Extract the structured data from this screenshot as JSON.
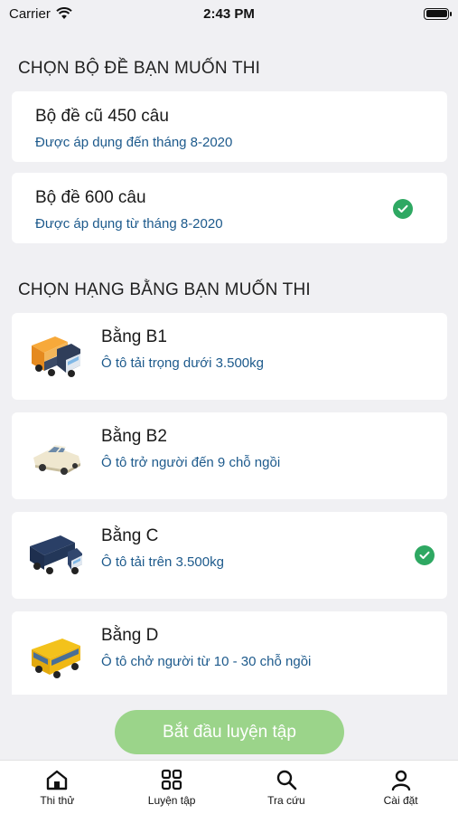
{
  "status_bar": {
    "carrier": "Carrier",
    "time": "2:43 PM"
  },
  "exam_set": {
    "heading": "CHỌN BỘ ĐỀ BẠN MUỐN THI",
    "options": [
      {
        "title": "Bộ đề cũ 450 câu",
        "subtitle": "Được áp dụng đến tháng 8-2020",
        "selected": false
      },
      {
        "title": "Bộ đề 600 câu",
        "subtitle": "Được áp dụng từ tháng 8-2020",
        "selected": true
      }
    ]
  },
  "license_class": {
    "heading": "CHỌN HẠNG BẰNG BẠN MUỐN THI",
    "options": [
      {
        "title": "Bằng B1",
        "subtitle": "Ô tô tải trọng dưới 3.500kg",
        "icon": "orange-truck-icon",
        "selected": false
      },
      {
        "title": "Bằng B2",
        "subtitle": "Ô tô trở người đến 9 chỗ ngồi",
        "icon": "sedan-car-icon",
        "selected": false
      },
      {
        "title": "Bằng C",
        "subtitle": "Ô tô tải trên 3.500kg",
        "icon": "blue-truck-icon",
        "selected": true
      },
      {
        "title": "Bằng D",
        "subtitle": "Ô tô chở người từ 10 - 30 chỗ ngồi",
        "icon": "bus-icon",
        "selected": false
      }
    ]
  },
  "start_button": {
    "label": "Bắt đầu luyện tập"
  },
  "tabbar": {
    "items": [
      {
        "label": "Thi thử",
        "icon": "home-icon"
      },
      {
        "label": "Luyện tập",
        "icon": "grid-icon"
      },
      {
        "label": "Tra cứu",
        "icon": "search-icon"
      },
      {
        "label": "Cài đặt",
        "icon": "person-icon"
      }
    ]
  },
  "colors": {
    "accent_green": "#2ea862",
    "button_green": "#9bd48a",
    "subtitle_blue": "#1d5a8c",
    "background": "#f0f0f3"
  }
}
